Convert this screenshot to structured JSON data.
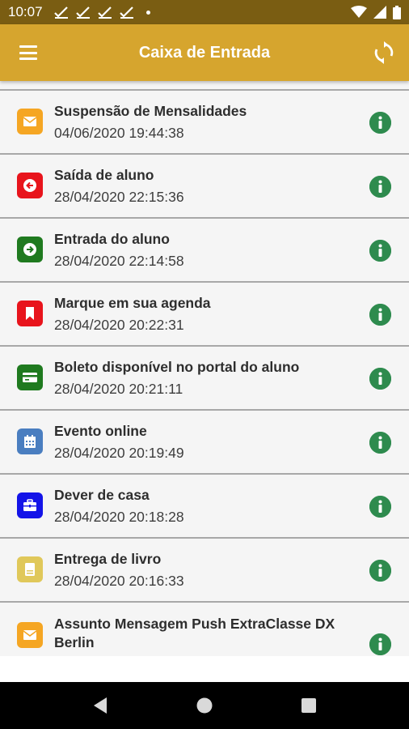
{
  "status_bar": {
    "time": "10:07",
    "notifications": [
      "check-all-icon",
      "check-all-icon",
      "check-all-icon",
      "check-all-icon"
    ]
  },
  "app_bar": {
    "title": "Caixa de Entrada",
    "menu_icon": "menu-icon",
    "sync_icon": "sync-icon"
  },
  "colors": {
    "status_bar": "#7a5d12",
    "app_bar": "#d6a52e",
    "info": "#2e8b4e",
    "list_bg": "#f5f5f5"
  },
  "messages": [
    {
      "title": "Suspensão de Mensalidades",
      "date": "04/06/2020 19:44:38",
      "icon": "envelope-icon",
      "color": "#f5a623"
    },
    {
      "title": "Saída de aluno",
      "date": "28/04/2020 22:15:36",
      "icon": "exit-arrow-icon",
      "color": "#e8141c"
    },
    {
      "title": "Entrada do aluno",
      "date": "28/04/2020 22:14:58",
      "icon": "enter-arrow-icon",
      "color": "#1f7a1f"
    },
    {
      "title": "Marque em sua agenda",
      "date": "28/04/2020 20:22:31",
      "icon": "bookmark-icon",
      "color": "#e8141c"
    },
    {
      "title": "Boleto disponível no portal do aluno",
      "date": "28/04/2020 20:21:11",
      "icon": "credit-card-icon",
      "color": "#1f7a1f"
    },
    {
      "title": "Evento online",
      "date": "28/04/2020 20:19:49",
      "icon": "calendar-icon",
      "color": "#4a7ec0"
    },
    {
      "title": "Dever de casa",
      "date": "28/04/2020 20:18:28",
      "icon": "briefcase-icon",
      "color": "#1414e8"
    },
    {
      "title": "Entrega de livro",
      "date": "28/04/2020 20:16:33",
      "icon": "book-icon",
      "color": "#e0c85a"
    },
    {
      "title": "Assunto Mensagem Push ExtraClasse DX Berlin",
      "date": "",
      "icon": "envelope-icon",
      "color": "#f5a623"
    }
  ],
  "info_icon": "info-icon",
  "nav": [
    "back-icon",
    "home-icon",
    "recents-icon"
  ]
}
